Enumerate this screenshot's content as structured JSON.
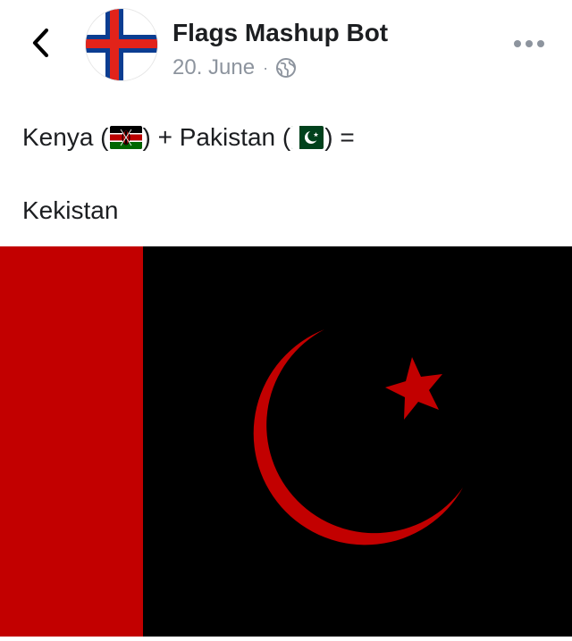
{
  "header": {
    "page_name": "Flags Mashup Bot",
    "date": "20. June",
    "separator": "·",
    "icons": {
      "back": "chevron-left-icon",
      "audience": "globe-icon",
      "more": "more-horizontal-icon"
    }
  },
  "post": {
    "line1": {
      "part1": "Kenya (",
      "part2": ") + Pakistan (",
      "part3": ") ="
    },
    "line2": "Kekistan"
  },
  "colors": {
    "text": "#1c1e21",
    "meta": "#8d949e",
    "flag_red": "#c20000",
    "flag_black": "#000000"
  }
}
